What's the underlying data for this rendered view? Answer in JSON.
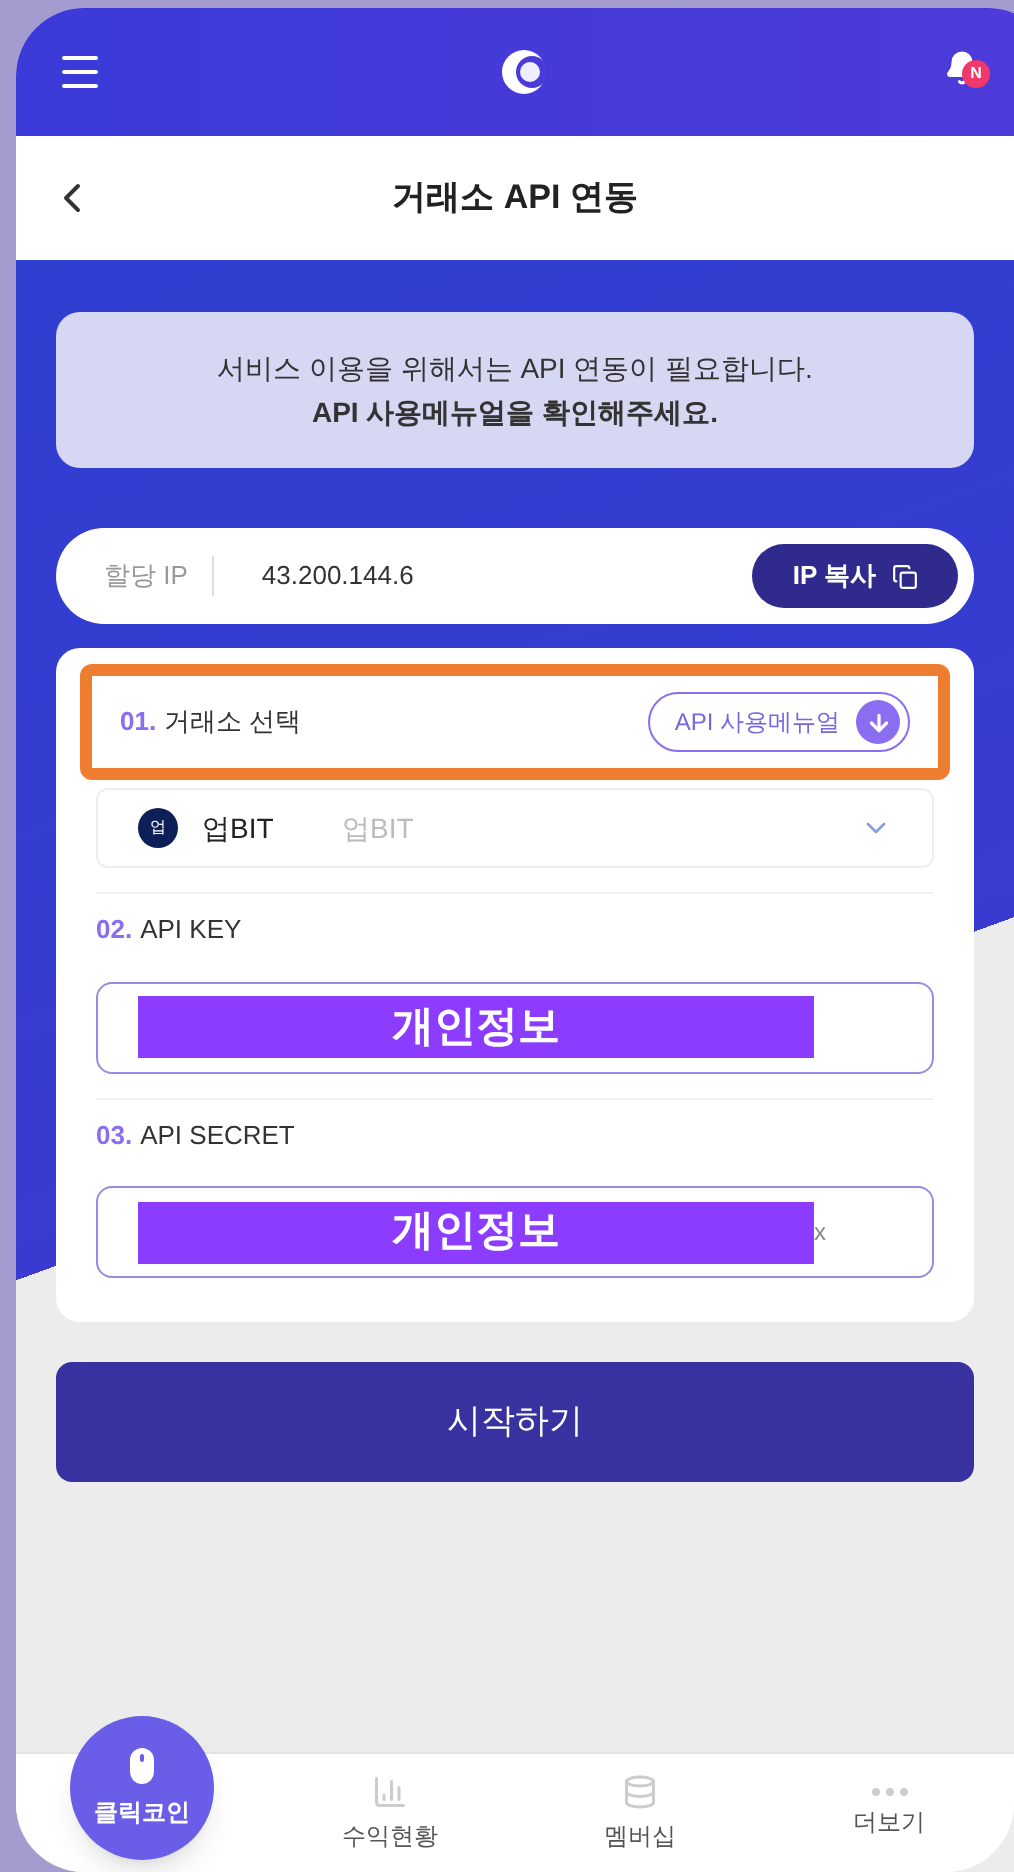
{
  "header": {
    "title": "거래소 API 연동",
    "notification_badge": "N"
  },
  "notice": {
    "lines": [
      "서비스 이용을 위해서는 API 연동이 필요합니다.",
      "API 사용메뉴얼을 확인해주세요."
    ]
  },
  "ip_bar": {
    "label": "할당 IP",
    "value": "43.200.144.6",
    "button": "IP 복사"
  },
  "sections": [
    {
      "kind": "select",
      "number": "01.",
      "title": "거래소 선택",
      "highlighted": true,
      "manual_button": "API 사용메뉴얼",
      "exchange_logo": "업",
      "exchange_name": "업BIT",
      "value": "업BIT"
    },
    {
      "kind": "input",
      "number": "02.",
      "title": "API KEY",
      "redaction": "개인정보"
    },
    {
      "kind": "input",
      "number": "03.",
      "title": "API SECRET",
      "redaction": "개인정보",
      "value_tail": "x"
    }
  ],
  "start_button": "시작하기",
  "nav": [
    {
      "kind": "main",
      "label": "클릭코인",
      "selected": true
    },
    {
      "kind": "chart",
      "label": "수익현황",
      "selected": false
    },
    {
      "kind": "coins",
      "label": "멤버십",
      "selected": false
    },
    {
      "kind": "more",
      "label": "더보기",
      "selected": false
    }
  ]
}
